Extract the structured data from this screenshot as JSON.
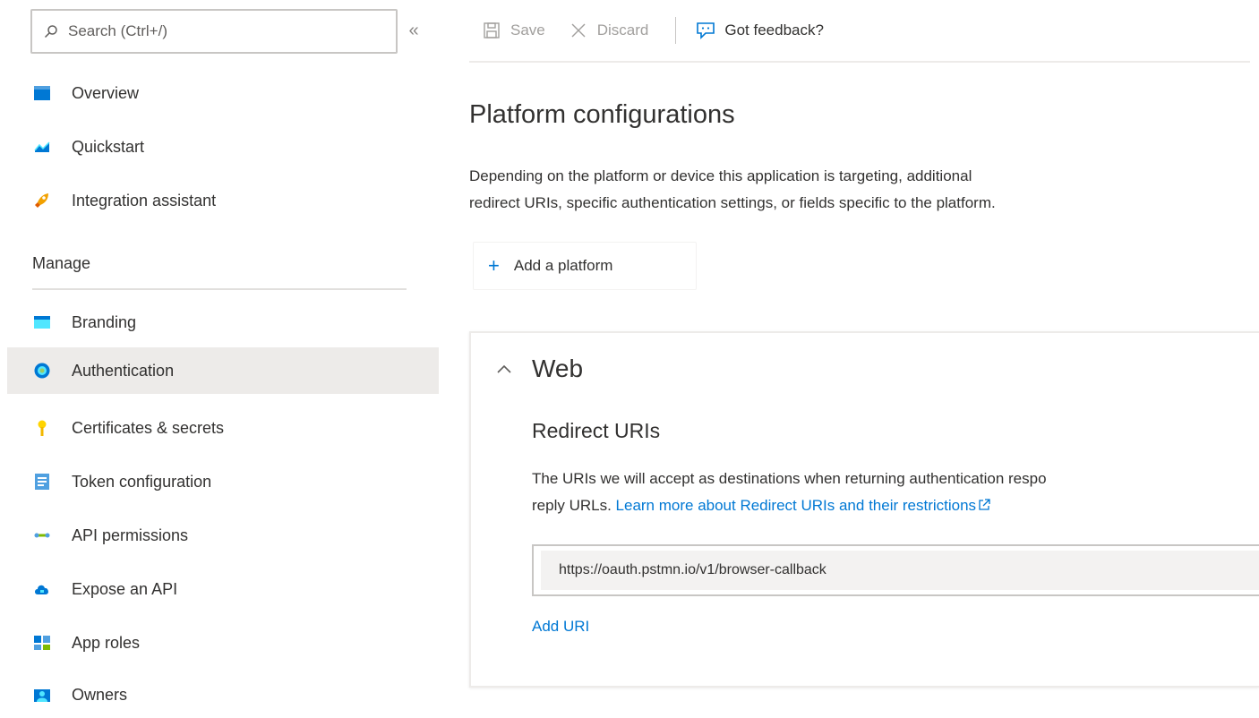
{
  "sidebar": {
    "search": {
      "placeholder": "Search (Ctrl+/)",
      "value": ""
    },
    "collapse_label": "«",
    "items_top": [
      {
        "label": "Overview",
        "icon": "overview-icon"
      },
      {
        "label": "Quickstart",
        "icon": "quickstart-icon"
      },
      {
        "label": "Integration assistant",
        "icon": "rocket-icon"
      }
    ],
    "section_label": "Manage",
    "items_manage": [
      {
        "label": "Branding",
        "icon": "branding-icon",
        "active": false
      },
      {
        "label": "Authentication",
        "icon": "authentication-icon",
        "active": true
      },
      {
        "label": "Certificates & secrets",
        "icon": "key-icon",
        "active": false
      },
      {
        "label": "Token configuration",
        "icon": "token-icon",
        "active": false
      },
      {
        "label": "API permissions",
        "icon": "api-permissions-icon",
        "active": false
      },
      {
        "label": "Expose an API",
        "icon": "cloud-icon",
        "active": false
      },
      {
        "label": "App roles",
        "icon": "app-roles-icon",
        "active": false
      },
      {
        "label": "Owners",
        "icon": "owners-icon",
        "active": false
      }
    ]
  },
  "toolbar": {
    "save_label": "Save",
    "discard_label": "Discard",
    "feedback_label": "Got feedback?"
  },
  "main": {
    "title": "Platform configurations",
    "description_line1": "Depending on the platform or device this application is targeting, additional",
    "description_line2": "redirect URIs, specific authentication settings, or fields specific to the platform.",
    "add_platform_label": "Add a platform",
    "web": {
      "title": "Web",
      "redirect_title": "Redirect URIs",
      "redirect_desc_line1": "The URIs we will accept as destinations when returning authentication respo",
      "redirect_desc_line2_prefix": "reply URLs. ",
      "redirect_link": "Learn more about Redirect URIs and their restrictions",
      "uri_value": "https://oauth.pstmn.io/v1/browser-callback",
      "add_uri_label": "Add URI"
    }
  },
  "colors": {
    "accent": "#0078d4",
    "active_bg": "#edebe9",
    "text": "#323130"
  }
}
